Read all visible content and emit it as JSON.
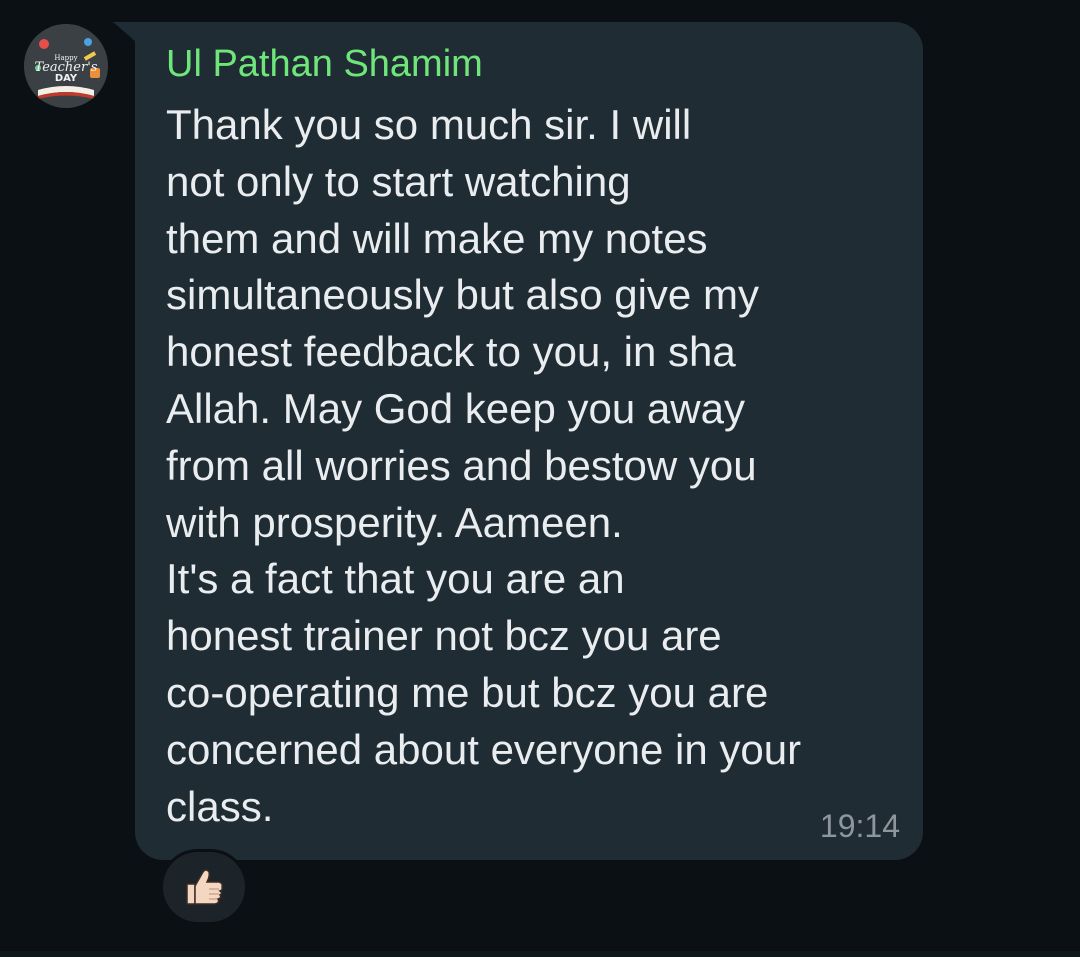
{
  "message": {
    "sender": "Ul Pathan Shamim",
    "lines": [
      "Thank you so much sir. I will",
      "not only to start watching",
      "them and will make my notes",
      "simultaneously but also give my",
      "honest feedback to you, in sha",
      "Allah. May God keep you away",
      "from all worries and bestow you",
      "with prosperity. Aameen.",
      "It's a fact that you are an",
      "honest trainer not bcz you are",
      "co-operating me but bcz you are",
      "concerned about everyone in your",
      "class."
    ],
    "time": "19:14",
    "reaction": "👍🏻"
  },
  "avatar": {
    "text_top": "Happy",
    "text_mid": "Teacher's",
    "text_bottom": "DAY",
    "icon": "teachers-day-avatar-icon"
  },
  "colors": {
    "background": "#0b1014",
    "bubble": "#202c33",
    "sender": "#6fe67a",
    "text": "#e9edef",
    "time": "#8c969c"
  }
}
